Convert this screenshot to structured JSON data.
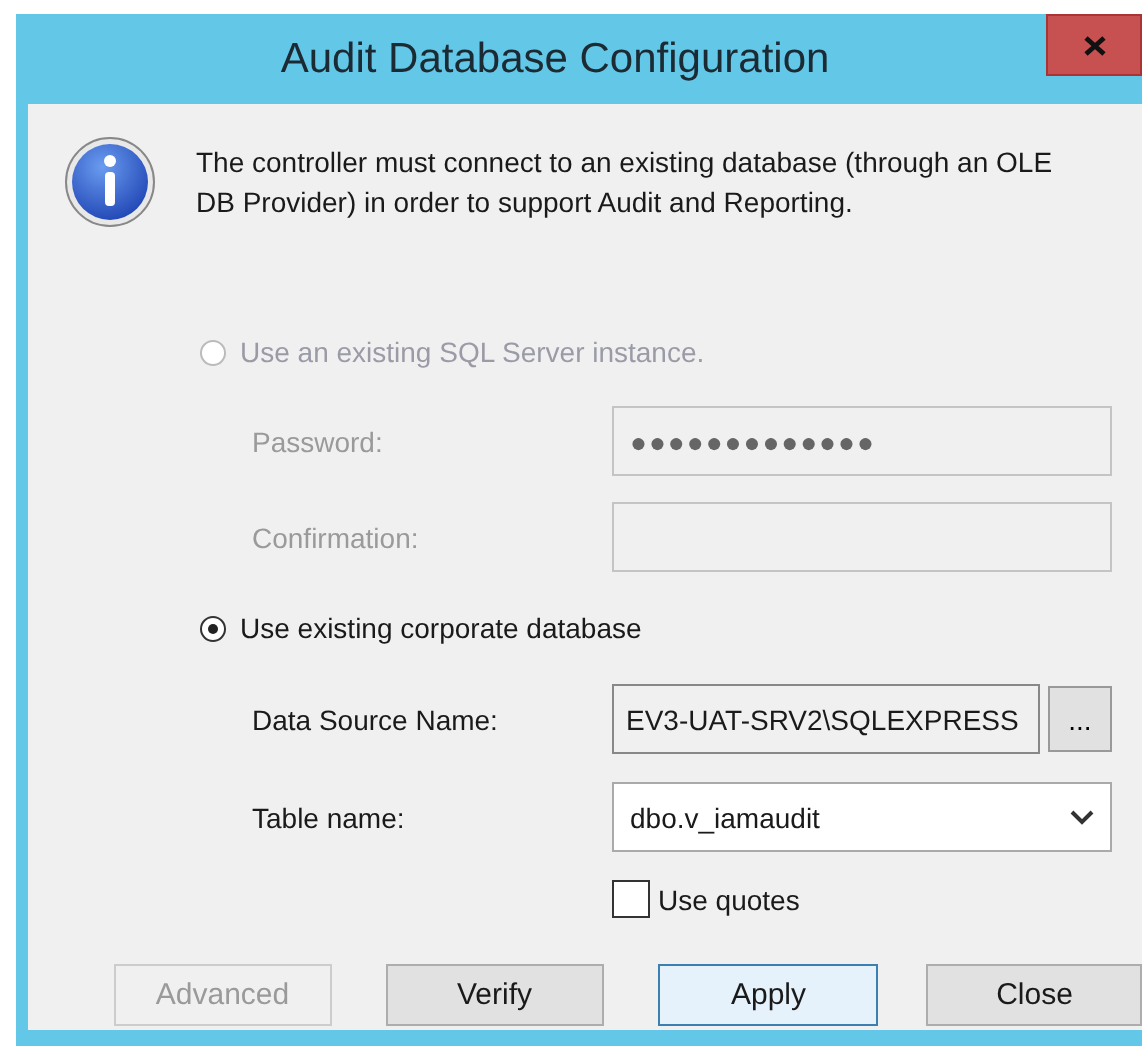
{
  "window": {
    "title": "Audit Database Configuration"
  },
  "message": "The controller must connect to an existing database (through an OLE DB Provider) in order to support Audit and Reporting.",
  "options": [
    {
      "label": "Use an existing SQL Server instance.",
      "selected": false,
      "disabled": true,
      "fields": [
        {
          "kind": "password",
          "label": "Password:",
          "value": "●●●●●●●●●●●●●",
          "disabled": true
        },
        {
          "kind": "password",
          "label": "Confirmation:",
          "disabled": true
        }
      ]
    },
    {
      "label": "Use existing corporate database",
      "selected": true,
      "disabled": false,
      "fields": [
        {
          "kind": "browse",
          "label": "Data Source Name:",
          "value": "EV3-UAT-SRV2\\SQLEXPRESS",
          "button": "...",
          "disabled": false
        },
        {
          "kind": "dropdown",
          "label": "Table name:",
          "value": "dbo.v_iamaudit",
          "disabled": false
        }
      ]
    }
  ],
  "use_quotes": {
    "label": "Use quotes",
    "checked": false
  },
  "buttons": [
    {
      "label": "Advanced",
      "disabled": true,
      "default": false
    },
    {
      "label": "Verify",
      "disabled": false,
      "default": false
    },
    {
      "label": "Apply",
      "disabled": false,
      "default": true
    },
    {
      "label": "Close",
      "disabled": false,
      "default": false
    }
  ]
}
